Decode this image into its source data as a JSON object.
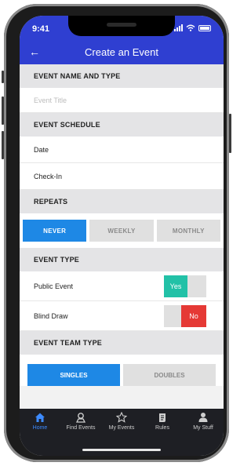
{
  "status": {
    "time": "9:41"
  },
  "appbar": {
    "back_icon": "back-arrow-icon",
    "title": "Create an Event"
  },
  "sections": {
    "name_type": "EVENT NAME AND TYPE",
    "schedule": "EVENT SCHEDULE",
    "repeats": "REPEATS",
    "type": "EVENT TYPE",
    "team_type": "EVENT TEAM TYPE"
  },
  "fields": {
    "event_title_placeholder": "Event Title",
    "date": "Date",
    "checkin": "Check-In"
  },
  "repeats": {
    "options": [
      "NEVER",
      "WEEKLY",
      "MONTHLY"
    ],
    "selected": "NEVER"
  },
  "event_type": {
    "public_label": "Public Event",
    "public_value": "Yes",
    "blind_label": "Blind Draw",
    "blind_value": "No"
  },
  "team_type": {
    "options": [
      "SINGLES",
      "DOUBLES"
    ],
    "selected": "SINGLES"
  },
  "tabbar": {
    "items": [
      {
        "label": "Home",
        "icon": "home-icon"
      },
      {
        "label": "Find Events",
        "icon": "map-pin-icon"
      },
      {
        "label": "My Events",
        "icon": "star-icon"
      },
      {
        "label": "Rules",
        "icon": "scroll-icon"
      },
      {
        "label": "My Stuff",
        "icon": "person-icon"
      }
    ],
    "active": "Home"
  },
  "colors": {
    "primary": "#2f3fd1",
    "accent": "#1e88e5",
    "yes": "#22c1a7",
    "no": "#e53935",
    "tab_active": "#3d8bff"
  }
}
